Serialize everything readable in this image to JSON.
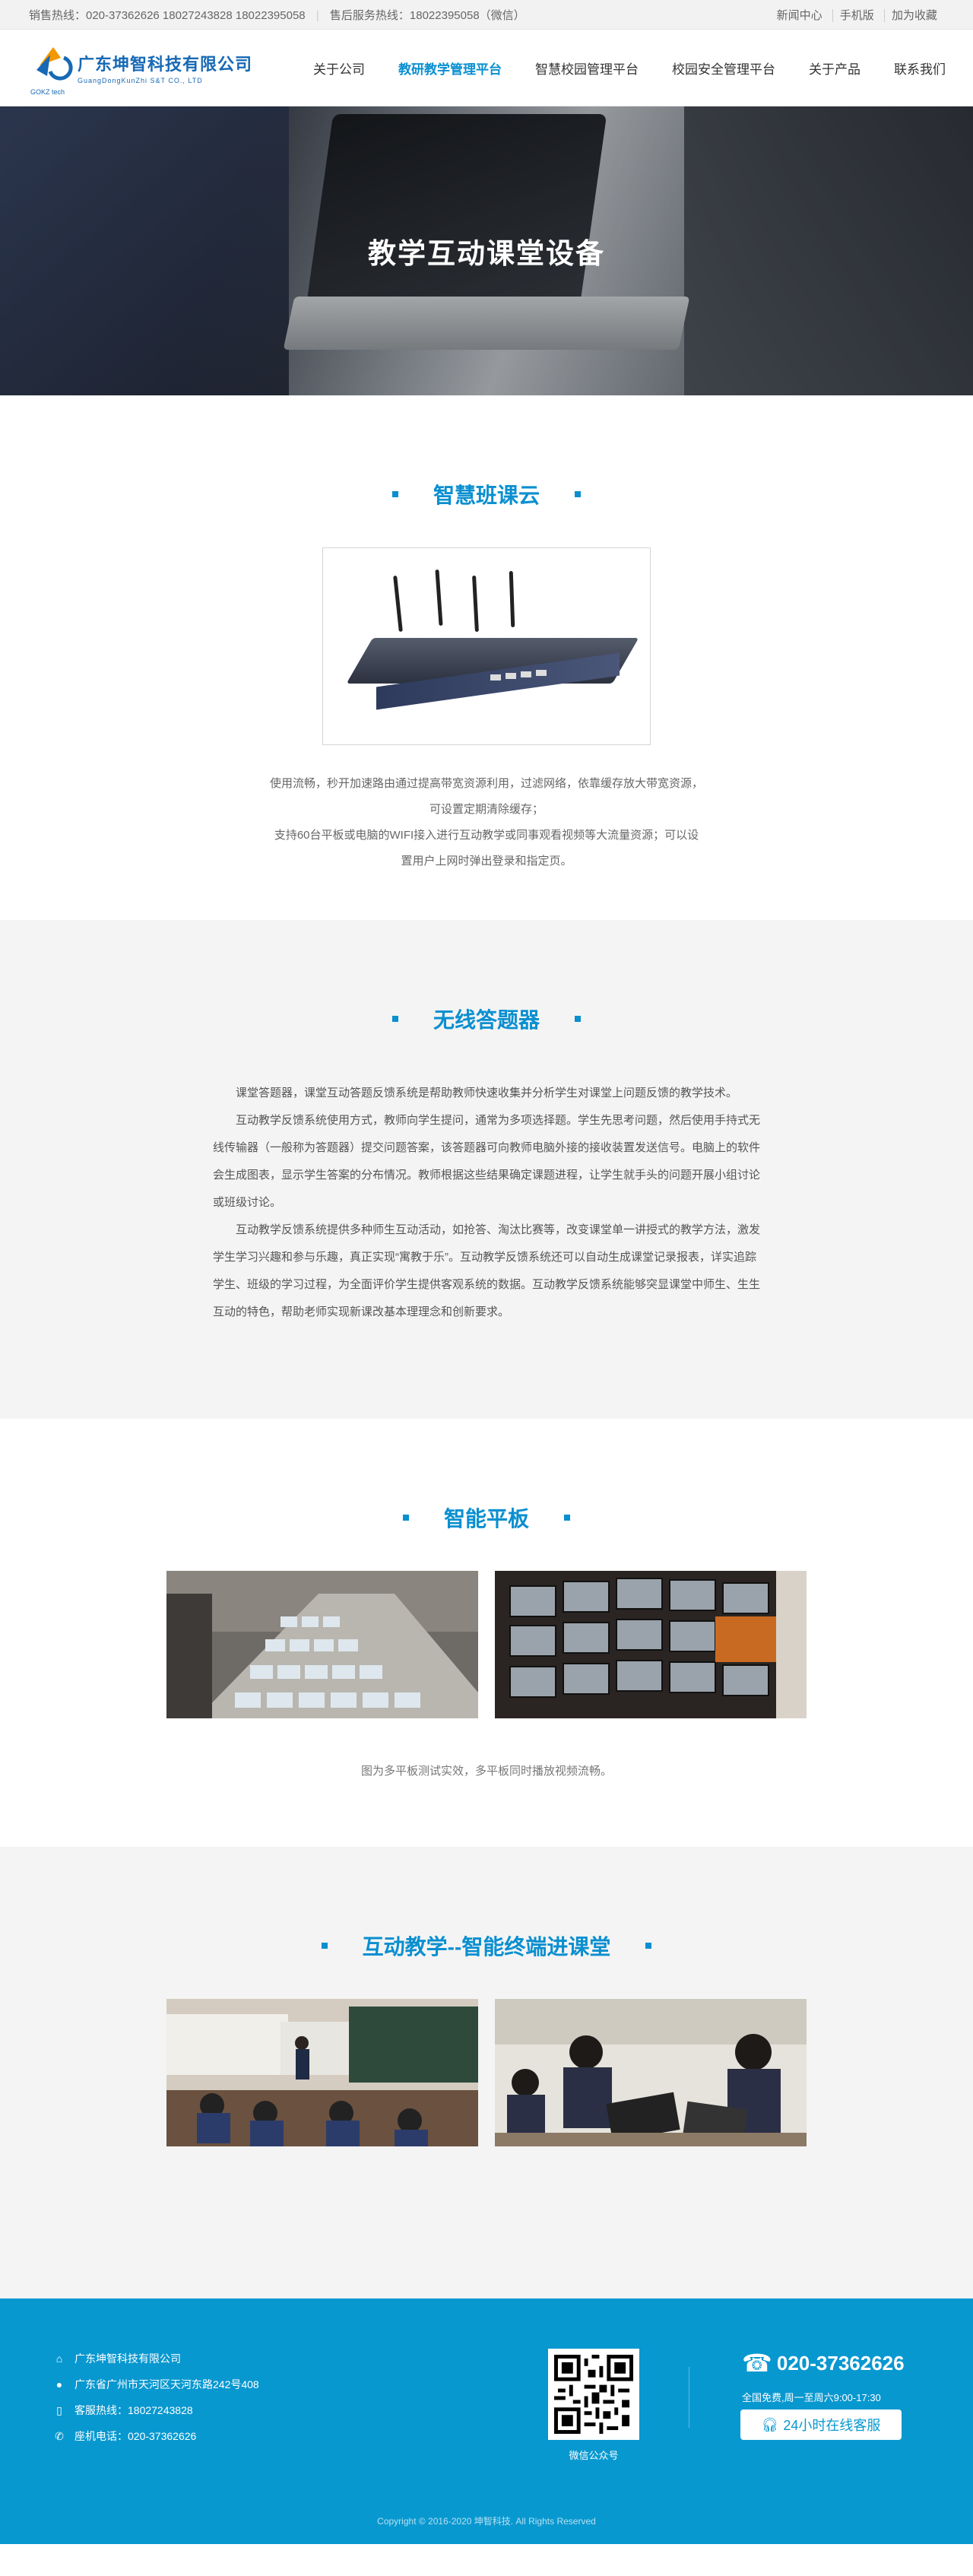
{
  "topbar": {
    "sales_hotline": "销售热线：020-37362626   18027243828   18022395058",
    "service_hotline": "售后服务热线：18022395058（微信）",
    "links": [
      "新闻中心",
      "手机版",
      "加为收藏"
    ]
  },
  "logo": {
    "name_cn": "广东坤智科技有限公司",
    "name_en": "GuangDongKunZhi S&T CO., LTD",
    "mark_text": "GOKZ tech"
  },
  "nav": [
    "关于公司",
    "教研教学管理平台",
    "智慧校园管理平台",
    "校园安全管理平台",
    "关于产品",
    "联系我们"
  ],
  "banner": {
    "title": "教学互动课堂设备"
  },
  "section1": {
    "title": "智慧班课云",
    "desc": [
      "使用流畅，秒开加速路由通过提高带宽资源利用，过滤网络，依靠缓存放大带宽资源，",
      "可设置定期清除缓存；",
      "支持60台平板或电脑的WIFI接入进行互动教学或同事观看视频等大流量资源；可以设",
      "置用户上网时弹出登录和指定页。"
    ]
  },
  "section2": {
    "title": "无线答题器",
    "paragraphs": [
      "课堂答题器，课堂互动答题反馈系统是帮助教师快速收集并分析学生对课堂上问题反馈的教学技术。",
      "互动教学反馈系统使用方式，教师向学生提问，通常为多项选择题。学生先思考问题，然后使用手持式无线传输器（一般称为答题器）提交问题答案，该答题器可向教师电脑外接的接收装置发送信号。电脑上的软件会生成图表，显示学生答案的分布情况。教师根据这些结果确定课题进程，让学生就手头的问题开展小组讨论或班级讨论。",
      "互动教学反馈系统提供多种师生互动活动，如抢答、淘汰比赛等，改变课堂单一讲授式的教学方法，激发学生学习兴趣和参与乐趣，真正实现“寓教于乐”。互动教学反馈系统还可以自动生成课堂记录报表，详实追踪学生、班级的学习过程，为全面评价学生提供客观系统的数据。互动教学反馈系统能够突显课堂中师生、生生互动的特色，帮助老师实现新课改基本理理念和创新要求。"
    ]
  },
  "section3": {
    "title": "智能平板",
    "caption": "图为多平板测试实效，多平板同时播放视频流畅。"
  },
  "section4": {
    "title": "互动教学--智能终端进课堂"
  },
  "footer": {
    "company": "广东坤智科技有限公司",
    "address": "广东省广州市天河区天河东路242号408",
    "service_phone": "客服热线：18027243828",
    "landline": "座机电话：020-37362626",
    "qr_caption": "微信公众号",
    "phone": "020-37362626",
    "hours": "全国免费,周一至周六9:00-17:30",
    "service_button": "24小时在线客服",
    "copyright": "Copyright © 2016-2020 坤智科技. All Rights Reserved"
  },
  "colors": {
    "accent": "#0a8fd0",
    "footer": "#0898d0"
  }
}
